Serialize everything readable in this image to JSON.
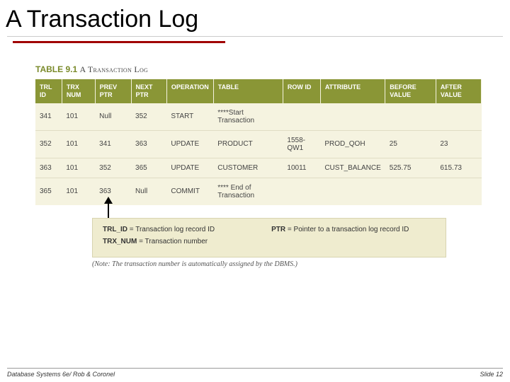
{
  "title": "A Transaction Log",
  "table": {
    "caption_num": "TABLE 9.1",
    "caption_title": "A Transaction Log",
    "headers": [
      "TRL ID",
      "TRX NUM",
      "PREV PTR",
      "NEXT PTR",
      "OPERATION",
      "TABLE",
      "ROW ID",
      "ATTRIBUTE",
      "BEFORE VALUE",
      "AFTER VALUE"
    ],
    "rows": [
      [
        "341",
        "101",
        "Null",
        "352",
        "START",
        "****Start Transaction",
        "",
        "",
        "",
        ""
      ],
      [
        "352",
        "101",
        "341",
        "363",
        "UPDATE",
        "PRODUCT",
        "1558-QW1",
        "PROD_QOH",
        "25",
        "23"
      ],
      [
        "363",
        "101",
        "352",
        "365",
        "UPDATE",
        "CUSTOMER",
        "10011",
        "CUST_BALANCE",
        "525.75",
        "615.73"
      ],
      [
        "365",
        "101",
        "363",
        "Null",
        "COMMIT",
        "**** End of Transaction",
        "",
        "",
        "",
        ""
      ]
    ]
  },
  "legend": {
    "trl_label": "TRL_ID",
    "trl_def": " = Transaction log record ID",
    "ptr_label": "PTR",
    "ptr_def": " = Pointer to a transaction log record ID",
    "trx_label": "TRX_NUM",
    "trx_def": " = Transaction number",
    "note": "(Note: The transaction number is automatically assigned by the DBMS.)"
  },
  "footer": {
    "left": "Database Systems 6e/ Rob & Coronel",
    "right": "Slide 12"
  }
}
